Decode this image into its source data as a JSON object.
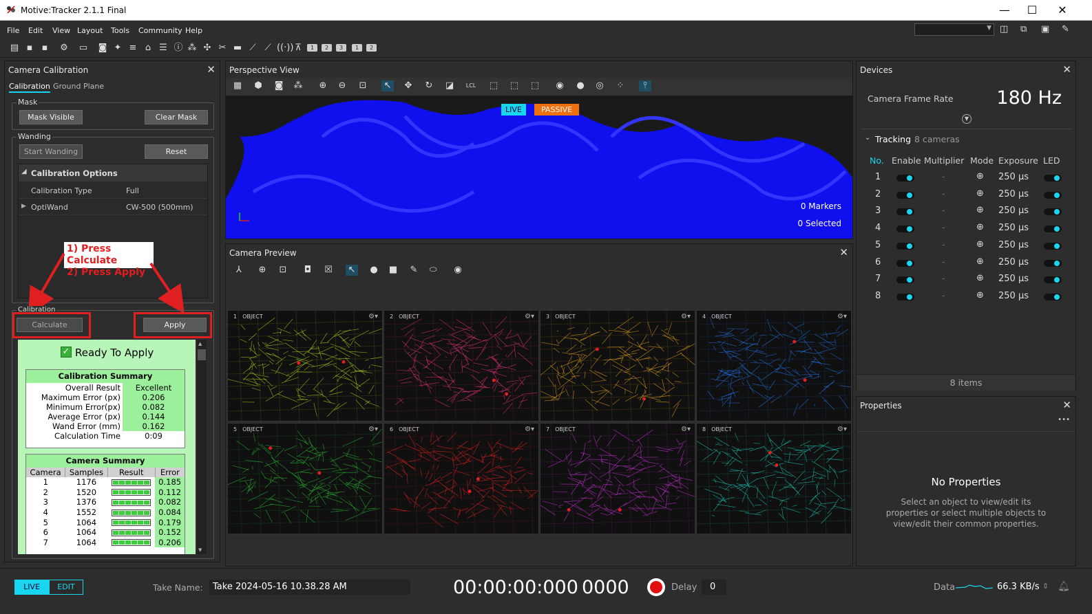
{
  "window": {
    "title": "Motive:Tracker 2.1.1 Final",
    "min": "—",
    "max": "☐",
    "close": "✕"
  },
  "menu": [
    "File",
    "Edit",
    "View",
    "Layout",
    "Tools",
    "Community",
    "Help"
  ],
  "toolbar_nums": [
    "1",
    "2",
    "3",
    "1",
    "2"
  ],
  "calib": {
    "title": "Camera Calibration",
    "tab_calibration": "Calibration",
    "tab_ground": "Ground Plane",
    "mask_label": "Mask",
    "mask_visible": "Mask Visible",
    "clear_mask": "Clear Mask",
    "wanding_label": "Wanding",
    "start_wanding": "Start Wanding",
    "reset": "Reset",
    "options_header": "Calibration Options",
    "opt_type_k": "Calibration Type",
    "opt_type_v": "Full",
    "opt_wand_k": "OptiWand",
    "opt_wand_v": "CW-500 (500mm)",
    "annot_1": "1) Press Calculate",
    "annot_2": "2) Press Apply",
    "calibration_label": "Calibration",
    "calculate": "Calculate",
    "apply": "Apply",
    "ready": "Ready To Apply",
    "summary_title": "Calibration Summary",
    "summary": [
      {
        "k": "Overall Result",
        "v": "Excellent"
      },
      {
        "k": "Maximum Error (px)",
        "v": "0.206"
      },
      {
        "k": "Minimum Error(px)",
        "v": "0.082"
      },
      {
        "k": "Average Error (px)",
        "v": "0.144"
      },
      {
        "k": "Wand Error (mm)",
        "v": "0.162"
      },
      {
        "k": "Calculation Time",
        "v": "0:09"
      }
    ],
    "camsum_title": "Camera Summary",
    "camsum_headers": [
      "Camera",
      "Samples",
      "Result",
      "Error"
    ],
    "camsum_rows": [
      {
        "cam": "1",
        "samples": "1176",
        "error": "0.185"
      },
      {
        "cam": "2",
        "samples": "1520",
        "error": "0.112"
      },
      {
        "cam": "3",
        "samples": "1376",
        "error": "0.082"
      },
      {
        "cam": "4",
        "samples": "1552",
        "error": "0.084"
      },
      {
        "cam": "5",
        "samples": "1064",
        "error": "0.179"
      },
      {
        "cam": "6",
        "samples": "1064",
        "error": "0.152"
      },
      {
        "cam": "7",
        "samples": "1064",
        "error": "0.206"
      }
    ]
  },
  "perspective": {
    "title": "Perspective View",
    "live": "LIVE",
    "passive": "PASSIVE",
    "markers": "0 Markers",
    "selected": "0 Selected",
    "lcl": "LCL"
  },
  "preview": {
    "title": "Camera Preview",
    "cams": [
      {
        "n": "1",
        "label": "OBJECT",
        "color": "#a8c81a"
      },
      {
        "n": "2",
        "label": "OBJECT",
        "color": "#e0307a"
      },
      {
        "n": "3",
        "label": "OBJECT",
        "color": "#d89a18"
      },
      {
        "n": "4",
        "label": "OBJECT",
        "color": "#2070e0"
      },
      {
        "n": "5",
        "label": "OBJECT",
        "color": "#28b030"
      },
      {
        "n": "6",
        "label": "OBJECT",
        "color": "#e02020"
      },
      {
        "n": "7",
        "label": "OBJECT",
        "color": "#c030d0"
      },
      {
        "n": "8",
        "label": "OBJECT",
        "color": "#18c0b0"
      }
    ]
  },
  "devices": {
    "title": "Devices",
    "frame_rate_label": "Camera Frame Rate",
    "frame_rate": "180 Hz",
    "tracking": "Tracking",
    "tracking_count": "8 cameras",
    "headers": [
      "No.",
      "Enable",
      "Multiplier",
      "Mode",
      "Exposure",
      "LED"
    ],
    "rows": [
      {
        "no": "1",
        "mult": "-",
        "exp": "250 µs"
      },
      {
        "no": "2",
        "mult": "-",
        "exp": "250 µs"
      },
      {
        "no": "3",
        "mult": "-",
        "exp": "250 µs"
      },
      {
        "no": "4",
        "mult": "-",
        "exp": "250 µs"
      },
      {
        "no": "5",
        "mult": "-",
        "exp": "250 µs"
      },
      {
        "no": "6",
        "mult": "-",
        "exp": "250 µs"
      },
      {
        "no": "7",
        "mult": "-",
        "exp": "250 µs"
      },
      {
        "no": "8",
        "mult": "-",
        "exp": "250 µs"
      }
    ],
    "items": "8 items"
  },
  "properties": {
    "title": "Properties",
    "menu": "•••",
    "none": "No Properties",
    "hint": "Select an object to view/edit its properties or select multiple objects to view/edit their common properties."
  },
  "bottom": {
    "live": "LIVE",
    "edit": "EDIT",
    "take_label": "Take Name:",
    "take_name": "Take 2024-05-16 10.38.28 AM",
    "timecode": "00:00:00:000",
    "frame": "0000",
    "delay_label": "Delay",
    "delay": "0",
    "data_label": "Data",
    "rate": "66.3 KB/s"
  },
  "colors": {
    "accent": "#19d6f0",
    "wand": "#1a1aff",
    "record": "#e01010",
    "annot": "#e02020"
  }
}
